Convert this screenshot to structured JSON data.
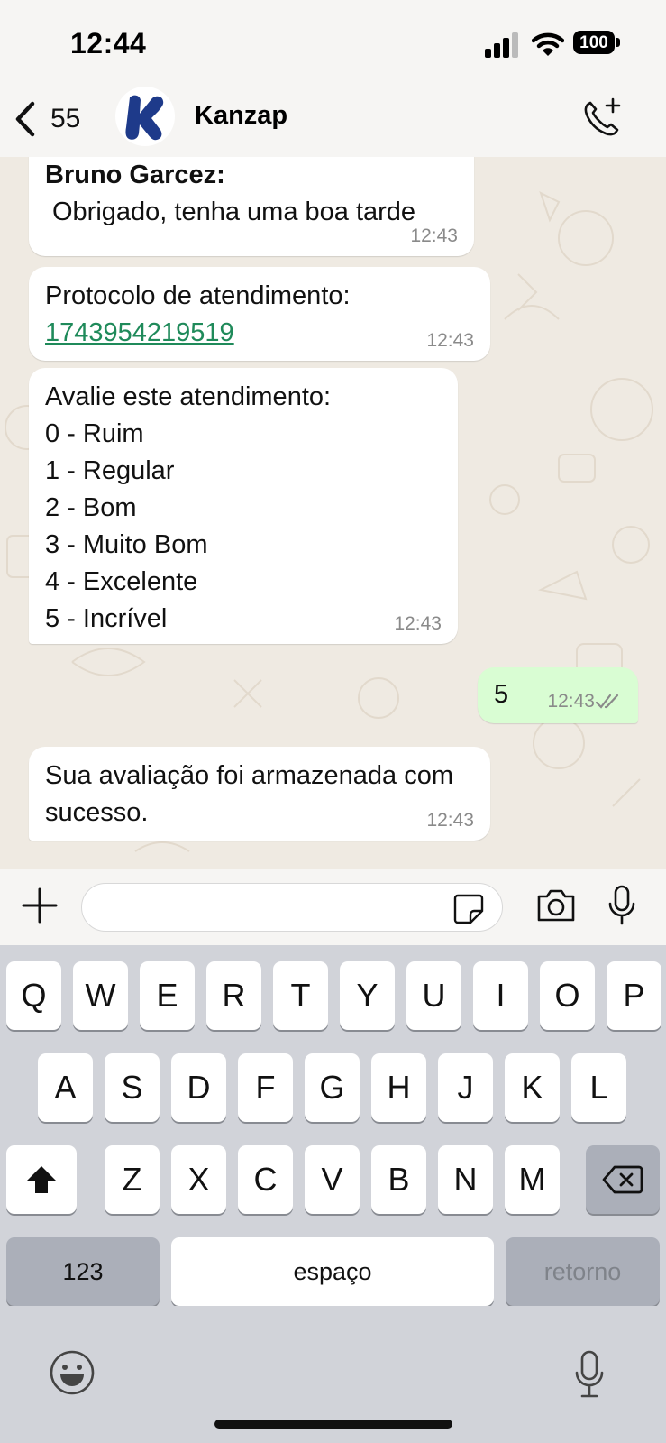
{
  "status_bar": {
    "time": "12:44",
    "battery": "100"
  },
  "header": {
    "back_count": "55",
    "contact_name": "Kanzap",
    "avatar_letter": "K",
    "brand_color": "#1e3a8a"
  },
  "messages": [
    {
      "sender": "Bruno Garcez:",
      "text": "Obrigado, tenha uma boa tarde",
      "time": "12:43"
    },
    {
      "line1": "Protocolo de atendimento:",
      "link": "1743954219519",
      "time": "12:43"
    },
    {
      "lines": [
        "Avalie este atendimento:",
        "0 - Ruim",
        "1 - Regular",
        "2 - Bom",
        "3 - Muito Bom",
        "4 - Excelente",
        "5 - Incrível"
      ],
      "time": "12:43"
    },
    {
      "text": "5",
      "time": "12:43",
      "outgoing": true
    },
    {
      "lines": [
        "Sua avaliação foi armazenada com",
        "sucesso."
      ],
      "time": "12:43"
    }
  ],
  "colors": {
    "outgoing_bubble": "#d9fdd3",
    "link": "#1f8a5a",
    "chat_bg": "#efeae2"
  },
  "keyboard": {
    "row1": [
      "Q",
      "W",
      "E",
      "R",
      "T",
      "Y",
      "U",
      "I",
      "O",
      "P"
    ],
    "row2": [
      "A",
      "S",
      "D",
      "F",
      "G",
      "H",
      "J",
      "K",
      "L"
    ],
    "row3": [
      "Z",
      "X",
      "C",
      "V",
      "B",
      "N",
      "M"
    ],
    "numbers": "123",
    "space": "espaço",
    "return": "retorno"
  },
  "icons": [
    "back-chevron-icon",
    "add-call-icon",
    "plus-icon",
    "sticker-icon",
    "camera-icon",
    "mic-icon",
    "shift-icon",
    "backspace-icon",
    "emoji-icon"
  ]
}
